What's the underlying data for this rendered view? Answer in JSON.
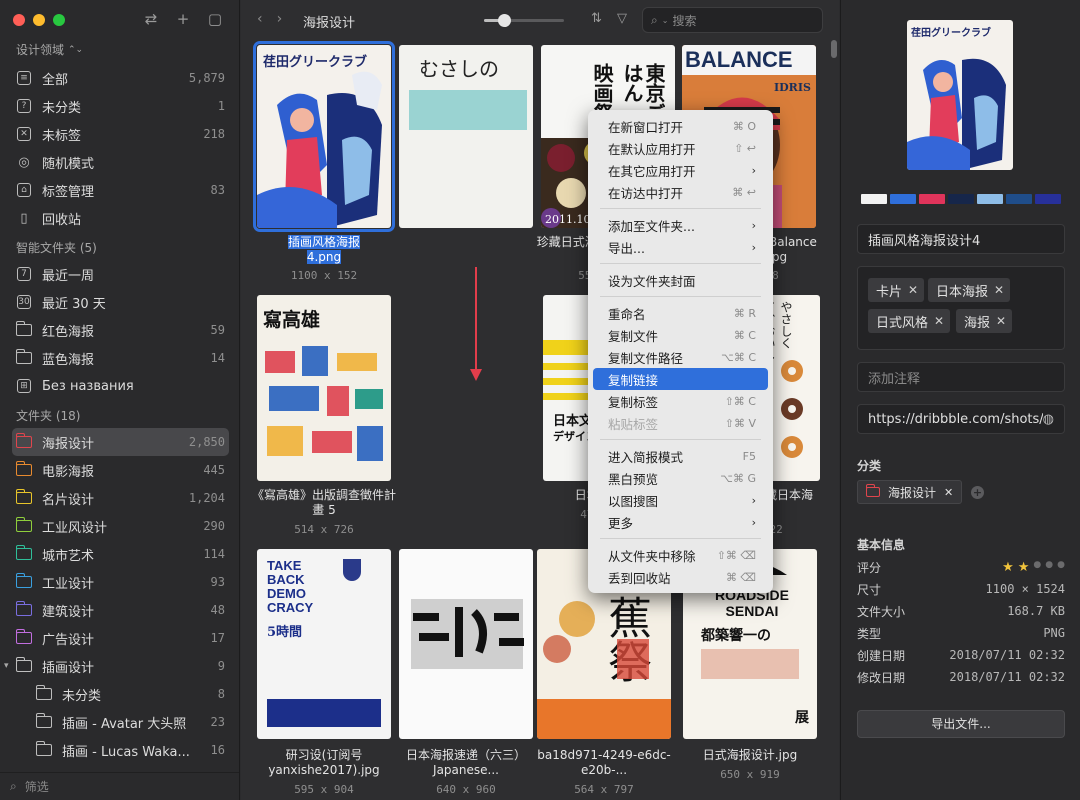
{
  "sidebar": {
    "library_title": "设计领域",
    "library": [
      {
        "label": "全部",
        "count": "5,879",
        "icon": "stack-icon"
      },
      {
        "label": "未分类",
        "count": "1",
        "icon": "question-box-icon"
      },
      {
        "label": "未标签",
        "count": "218",
        "icon": "x-box-icon"
      },
      {
        "label": "随机模式",
        "count": "",
        "icon": "bulb-icon"
      },
      {
        "label": "标签管理",
        "count": "83",
        "icon": "tag-box-icon"
      },
      {
        "label": "回收站",
        "count": "",
        "icon": "trash-icon"
      }
    ],
    "smart_title": "智能文件夹 (5)",
    "smart": [
      {
        "label": "最近一周",
        "count": "",
        "icon": "calendar-7-icon"
      },
      {
        "label": "最近 30 天",
        "count": "",
        "icon": "calendar-30-icon"
      },
      {
        "label": "红色海报",
        "count": "59",
        "icon": "smart-folder-icon"
      },
      {
        "label": "蓝色海报",
        "count": "14",
        "icon": "smart-folder-icon"
      },
      {
        "label": "Без названия",
        "count": "",
        "icon": "grid-icon"
      }
    ],
    "folders_title": "文件夹 (18)",
    "folders": [
      {
        "label": "海报设计",
        "count": "2,850",
        "color": "#e0454d",
        "selected": true
      },
      {
        "label": "电影海报",
        "count": "445",
        "color": "#e88a2f"
      },
      {
        "label": "名片设计",
        "count": "1,204",
        "color": "#e8c52a"
      },
      {
        "label": "工业风设计",
        "count": "290",
        "color": "#8fcf3c"
      },
      {
        "label": "城市艺术",
        "count": "114",
        "color": "#2fbf9a"
      },
      {
        "label": "工业设计",
        "count": "93",
        "color": "#3aa0e0"
      },
      {
        "label": "建筑设计",
        "count": "48",
        "color": "#7a6ee0"
      },
      {
        "label": "广告设计",
        "count": "17",
        "color": "#c26ee0"
      },
      {
        "label": "插画设计",
        "count": "9",
        "color": "#c0c0c0",
        "expanded": true
      }
    ],
    "subfolders": [
      {
        "label": "未分类",
        "count": "8"
      },
      {
        "label": "插画 - Avatar 大头照",
        "count": "23"
      },
      {
        "label": "插画 - Lucas Waka...",
        "count": "16"
      }
    ],
    "filter_placeholder": "筛选"
  },
  "toolbar": {
    "breadcrumb": "海报设计",
    "search_placeholder": "搜索",
    "zoom_level": 0.25
  },
  "grid": [
    {
      "caption_hl": "插画风格海报",
      "caption_rest": "4.png",
      "dims": "1100 x 152",
      "selected": true
    },
    {
      "caption": "",
      "dims": ""
    },
    {
      "caption": "珍藏日式海报系列分享.jpg",
      "dims": "550 x 778"
    },
    {
      "caption": "New free mag Balance launches.jpg",
      "dims": "591 x 788"
    },
    {
      "caption": "《寫高雄》出版調查徵件計畫 5",
      "dims": "514 x 726"
    },
    {
      "caption": "",
      "dims": ""
    },
    {
      "caption": "日本文化.jpg",
      "dims": "478 x 675"
    },
    {
      "caption": "佳作欣赏：珍藏日本海报.jpg",
      "dims": "440 x 622"
    },
    {
      "caption": "研习设(订阅号yanxishe2017).jpg",
      "dims": "595 x 904"
    },
    {
      "caption": "日本海报速递（六三） Japanese...",
      "dims": "640 x 960"
    },
    {
      "caption": "ba18d971-4249-e6dc-e20b-...",
      "dims": "564 x 797"
    },
    {
      "caption": "日式海报设计.jpg",
      "dims": "650 x 919"
    }
  ],
  "posters": {
    "p1_title": "荏田グリークラブ",
    "p2_title": "むさしの",
    "p3_a": "映画祭",
    "p3_b": "東京ごはん",
    "p3_date": "2011.10.8 10.23",
    "p4_title": "BALANCE",
    "p4_sub": "IDRIS",
    "p4_happy": "happy",
    "p5_title": "寫高雄",
    "p7_title": "日本文化",
    "p7_sub": "デザイン塾",
    "p8_title": "やさしくて、おいしい。",
    "p9_lines": "TAKE BACK DEMO CRACY",
    "p9_time": "5時間",
    "p11_title": "芭蕉祭",
    "p12_title": "ROADSIDE SENDAI",
    "p12_sub": "都築響一の",
    "p12_tail": "展"
  },
  "context_menu": {
    "groups": [
      [
        {
          "label": "在新窗口打开",
          "shortcut": "⌘ O"
        },
        {
          "label": "在默认应用打开",
          "shortcut": "⇧ ↩"
        },
        {
          "label": "在其它应用打开",
          "submenu": true
        },
        {
          "label": "在访达中打开",
          "shortcut": "⌘ ↩"
        }
      ],
      [
        {
          "label": "添加至文件夹...",
          "submenu": true
        },
        {
          "label": "导出...",
          "submenu": true
        }
      ],
      [
        {
          "label": "设为文件夹封面"
        }
      ],
      [
        {
          "label": "重命名",
          "shortcut": "⌘ R"
        },
        {
          "label": "复制文件",
          "shortcut": "⌘ C"
        },
        {
          "label": "复制文件路径",
          "shortcut": "⌥⌘ C"
        },
        {
          "label": "复制链接",
          "highlighted": true
        },
        {
          "label": "复制标签",
          "shortcut": "⇧⌘ C"
        },
        {
          "label": "粘贴标签",
          "shortcut": "⇧⌘ V",
          "disabled": true
        }
      ],
      [
        {
          "label": "进入简报模式",
          "shortcut": "F5"
        },
        {
          "label": "黑白预览",
          "shortcut": "⌥⌘ G"
        },
        {
          "label": "以图搜图",
          "submenu": true
        },
        {
          "label": "更多",
          "submenu": true
        }
      ],
      [
        {
          "label": "从文件夹中移除",
          "shortcut": "⇧⌘ ⌫"
        },
        {
          "label": "丢到回收站",
          "shortcut": "⌘ ⌫"
        }
      ]
    ]
  },
  "inspector": {
    "swatches": [
      "#f2f2f2",
      "#2f6fdb",
      "#e0345b",
      "#16264a",
      "#8ebde8",
      "#1f4d8a",
      "#27309a"
    ],
    "name": "插画风格海报设计4",
    "tags": [
      "卡片",
      "日本海报",
      "日式风格",
      "海报"
    ],
    "note_placeholder": "添加注释",
    "url": "https://dribbble.com/shots/:",
    "category_title": "分类",
    "category_folder": "海报设计",
    "info_title": "基本信息",
    "rating_label": "评分",
    "rating": 2,
    "info": [
      {
        "k": "尺寸",
        "v": "1100 × 1524"
      },
      {
        "k": "文件大小",
        "v": "168.7 KB"
      },
      {
        "k": "类型",
        "v": "PNG"
      },
      {
        "k": "创建日期",
        "v": "2018/07/11 02:32"
      },
      {
        "k": "修改日期",
        "v": "2018/07/11 02:32"
      }
    ],
    "export_label": "导出文件..."
  }
}
